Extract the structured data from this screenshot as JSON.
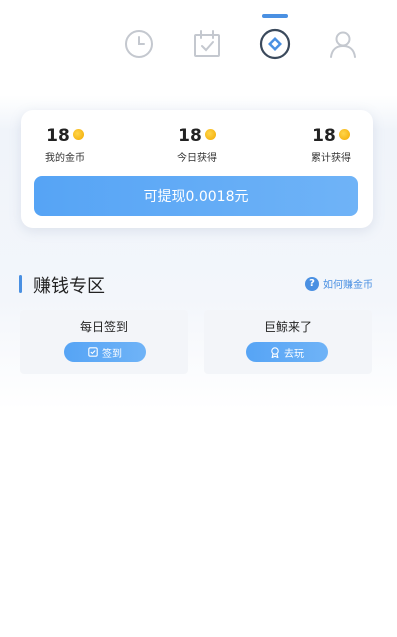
{
  "nav": {
    "tabs": [
      {
        "id": "history",
        "icon": "clock-icon"
      },
      {
        "id": "checkin",
        "icon": "calendar-check-icon"
      },
      {
        "id": "earn",
        "icon": "diamond-icon",
        "active": true
      },
      {
        "id": "profile",
        "icon": "user-icon"
      }
    ]
  },
  "stats": {
    "my_coins": {
      "value": "18",
      "label": "我的金币"
    },
    "today_earned": {
      "value": "18",
      "label": "今日获得"
    },
    "total_earned": {
      "value": "18",
      "label": "累计获得"
    }
  },
  "withdraw": {
    "label": "可提现0.0018元"
  },
  "section": {
    "title": "赚钱专区",
    "help_label": "如何赚金币",
    "help_icon": "question-icon"
  },
  "tasks": [
    {
      "title": "每日签到",
      "button": "签到",
      "icon": "check-square-icon"
    },
    {
      "title": "巨鲸来了",
      "button": "去玩",
      "icon": "badge-icon"
    }
  ],
  "colors": {
    "accent": "#4a90e2",
    "button_start": "#56a4f5",
    "button_end": "#6fb3f7",
    "coin": "#f2a900",
    "icon_gray": "#c4c8cf"
  }
}
